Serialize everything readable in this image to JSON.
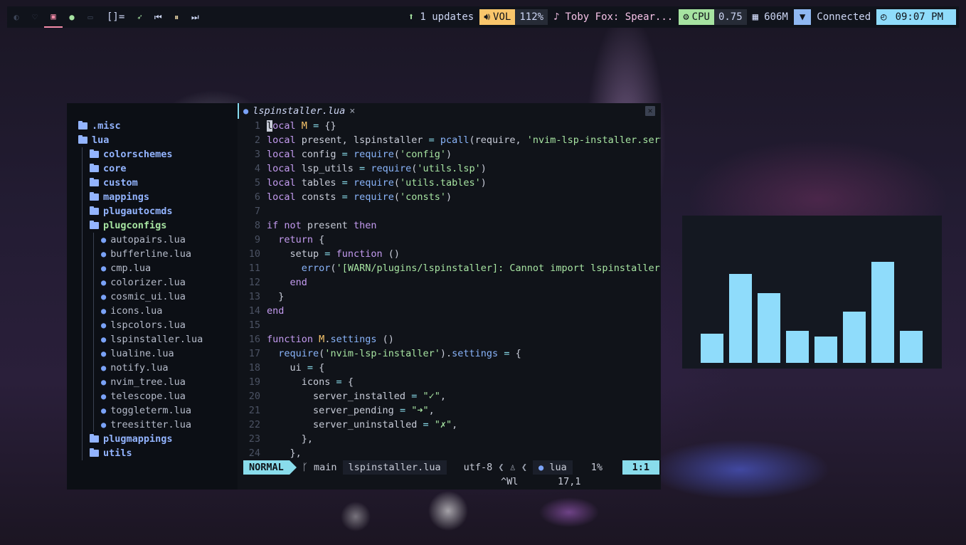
{
  "topbar": {
    "workspaces": [
      {
        "icon": "moon-icon"
      },
      {
        "icon": "heart-icon"
      },
      {
        "icon": "terminal-icon",
        "active": true
      },
      {
        "icon": "spotify-icon"
      },
      {
        "icon": "window-icon"
      }
    ],
    "layout_indicator": "[]=",
    "media_controls": [
      "rocket-icon",
      "previous-icon",
      "pause-icon",
      "next-icon"
    ],
    "updates": "1 updates",
    "volume_label": "VOL",
    "volume_value": "112%",
    "now_playing": "Toby Fox: Spear...",
    "cpu_label": "CPU",
    "cpu_value": "0.75",
    "memory": "606M",
    "network": "Connected",
    "clock": "09:07 PM"
  },
  "tree": {
    "items": [
      {
        "type": "dir",
        "depth": 0,
        "name": ".misc"
      },
      {
        "type": "dir",
        "depth": 0,
        "name": "lua"
      },
      {
        "type": "dir",
        "depth": 1,
        "name": "colorschemes"
      },
      {
        "type": "dir",
        "depth": 1,
        "name": "core"
      },
      {
        "type": "dir",
        "depth": 1,
        "name": "custom"
      },
      {
        "type": "dir",
        "depth": 1,
        "name": "mappings"
      },
      {
        "type": "dir",
        "depth": 1,
        "name": "plugautocmds"
      },
      {
        "type": "dir",
        "depth": 1,
        "name": "plugconfigs",
        "highlight": true
      },
      {
        "type": "file",
        "depth": 2,
        "name": "autopairs.lua"
      },
      {
        "type": "file",
        "depth": 2,
        "name": "bufferline.lua"
      },
      {
        "type": "file",
        "depth": 2,
        "name": "cmp.lua"
      },
      {
        "type": "file",
        "depth": 2,
        "name": "colorizer.lua"
      },
      {
        "type": "file",
        "depth": 2,
        "name": "cosmic_ui.lua"
      },
      {
        "type": "file",
        "depth": 2,
        "name": "icons.lua"
      },
      {
        "type": "file",
        "depth": 2,
        "name": "lspcolors.lua"
      },
      {
        "type": "file",
        "depth": 2,
        "name": "lspinstaller.lua"
      },
      {
        "type": "file",
        "depth": 2,
        "name": "lualine.lua"
      },
      {
        "type": "file",
        "depth": 2,
        "name": "notify.lua"
      },
      {
        "type": "file",
        "depth": 2,
        "name": "nvim_tree.lua"
      },
      {
        "type": "file",
        "depth": 2,
        "name": "telescope.lua"
      },
      {
        "type": "file",
        "depth": 2,
        "name": "toggleterm.lua"
      },
      {
        "type": "file",
        "depth": 2,
        "name": "treesitter.lua"
      },
      {
        "type": "dir",
        "depth": 1,
        "name": "plugmappings"
      },
      {
        "type": "dir",
        "depth": 1,
        "name": "utils"
      }
    ]
  },
  "tab": {
    "filename": "lspinstaller.lua",
    "close": "×"
  },
  "code": {
    "lines": [
      [
        [
          "kw",
          "local"
        ],
        [
          "pl",
          " "
        ],
        [
          "var",
          "M"
        ],
        [
          "pl",
          " "
        ],
        [
          "op",
          "="
        ],
        [
          "pl",
          " {}"
        ]
      ],
      [
        [
          "kw",
          "local"
        ],
        [
          "pl",
          " present, lspinstaller "
        ],
        [
          "op",
          "="
        ],
        [
          "pl",
          " "
        ],
        [
          "fn",
          "pcall"
        ],
        [
          "pl",
          "(require, "
        ],
        [
          "str",
          "'nvim-lsp-installer.serv"
        ]
      ],
      [
        [
          "kw",
          "local"
        ],
        [
          "pl",
          " config "
        ],
        [
          "op",
          "="
        ],
        [
          "pl",
          " "
        ],
        [
          "fn",
          "require"
        ],
        [
          "pl",
          "("
        ],
        [
          "str",
          "'config'"
        ],
        [
          "pl",
          ")"
        ]
      ],
      [
        [
          "kw",
          "local"
        ],
        [
          "pl",
          " lsp_utils "
        ],
        [
          "op",
          "="
        ],
        [
          "pl",
          " "
        ],
        [
          "fn",
          "require"
        ],
        [
          "pl",
          "("
        ],
        [
          "str",
          "'utils.lsp'"
        ],
        [
          "pl",
          ")"
        ]
      ],
      [
        [
          "kw",
          "local"
        ],
        [
          "pl",
          " tables "
        ],
        [
          "op",
          "="
        ],
        [
          "pl",
          " "
        ],
        [
          "fn",
          "require"
        ],
        [
          "pl",
          "("
        ],
        [
          "str",
          "'utils.tables'"
        ],
        [
          "pl",
          ")"
        ]
      ],
      [
        [
          "kw",
          "local"
        ],
        [
          "pl",
          " consts "
        ],
        [
          "op",
          "="
        ],
        [
          "pl",
          " "
        ],
        [
          "fn",
          "require"
        ],
        [
          "pl",
          "("
        ],
        [
          "str",
          "'consts'"
        ],
        [
          "pl",
          ")"
        ]
      ],
      [],
      [
        [
          "kw",
          "if"
        ],
        [
          "pl",
          " "
        ],
        [
          "kw",
          "not"
        ],
        [
          "pl",
          " present "
        ],
        [
          "kw",
          "then"
        ]
      ],
      [
        [
          "pl",
          "  "
        ],
        [
          "kw",
          "return"
        ],
        [
          "pl",
          " {"
        ]
      ],
      [
        [
          "pl",
          "    setup "
        ],
        [
          "op",
          "="
        ],
        [
          "pl",
          " "
        ],
        [
          "kw",
          "function"
        ],
        [
          "pl",
          " ()"
        ]
      ],
      [
        [
          "pl",
          "      "
        ],
        [
          "fn",
          "error"
        ],
        [
          "pl",
          "("
        ],
        [
          "str",
          "'[WARN/plugins/lspinstaller]: Cannot import lspinstaller'"
        ]
      ],
      [
        [
          "pl",
          "    "
        ],
        [
          "kw",
          "end"
        ]
      ],
      [
        [
          "pl",
          "  }"
        ]
      ],
      [
        [
          "kw",
          "end"
        ]
      ],
      [],
      [
        [
          "kw",
          "function"
        ],
        [
          "pl",
          " "
        ],
        [
          "var",
          "M"
        ],
        [
          "pl",
          "."
        ],
        [
          "fn",
          "settings"
        ],
        [
          "pl",
          " ()"
        ]
      ],
      [
        [
          "pl",
          "  "
        ],
        [
          "fn",
          "require"
        ],
        [
          "pl",
          "("
        ],
        [
          "str",
          "'nvim-lsp-installer'"
        ],
        [
          "pl",
          ")."
        ],
        [
          "fn",
          "settings"
        ],
        [
          "pl",
          " "
        ],
        [
          "op",
          "="
        ],
        [
          "pl",
          " {"
        ]
      ],
      [
        [
          "pl",
          "    ui "
        ],
        [
          "op",
          "="
        ],
        [
          "pl",
          " {"
        ]
      ],
      [
        [
          "pl",
          "      icons "
        ],
        [
          "op",
          "="
        ],
        [
          "pl",
          " {"
        ]
      ],
      [
        [
          "pl",
          "        server_installed "
        ],
        [
          "op",
          "="
        ],
        [
          "pl",
          " "
        ],
        [
          "str",
          "\"✓\""
        ],
        [
          "pl",
          ","
        ]
      ],
      [
        [
          "pl",
          "        server_pending "
        ],
        [
          "op",
          "="
        ],
        [
          "pl",
          " "
        ],
        [
          "str",
          "\"➜\""
        ],
        [
          "pl",
          ","
        ]
      ],
      [
        [
          "pl",
          "        server_uninstalled "
        ],
        [
          "op",
          "="
        ],
        [
          "pl",
          " "
        ],
        [
          "str",
          "\"✗\""
        ],
        [
          "pl",
          ","
        ]
      ],
      [
        [
          "pl",
          "      },"
        ]
      ],
      [
        [
          "pl",
          "    },"
        ]
      ]
    ]
  },
  "statusline": {
    "mode": "NORMAL",
    "branch": "main",
    "file": "lspinstaller.lua",
    "encoding": "utf-8",
    "filetype": "lua",
    "percent": "1%",
    "position": "1:1"
  },
  "cmdline": {
    "keys": "^Wl",
    "ruler": "17,1"
  },
  "visualizer": {
    "levels": [
      0.29,
      0.88,
      0.69,
      0.32,
      0.26,
      0.51,
      1.0,
      0.32
    ]
  }
}
